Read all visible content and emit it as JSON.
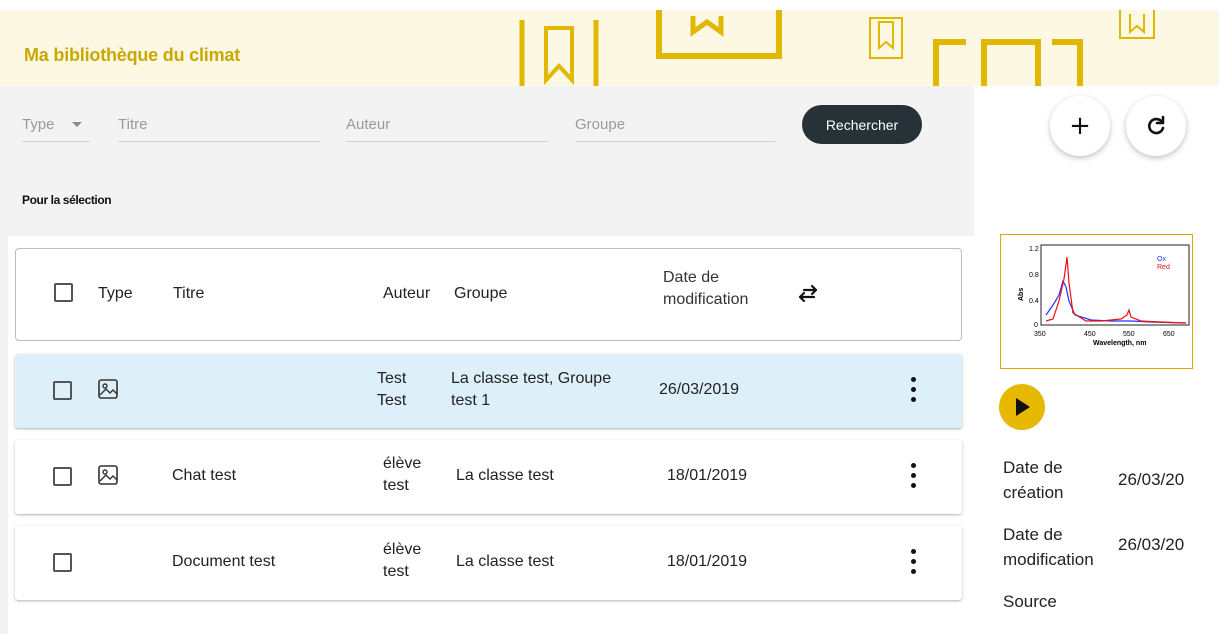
{
  "header": {
    "title": "Ma bibliothèque du climat"
  },
  "filters": {
    "type_label": "Type",
    "title_placeholder": "Titre",
    "author_placeholder": "Auteur",
    "group_placeholder": "Groupe",
    "search_label": "Rechercher"
  },
  "selection_label": "Pour la sélection",
  "table": {
    "columns": {
      "type": "Type",
      "title": "Titre",
      "author": "Auteur",
      "group": "Groupe",
      "date_line1": "Date de",
      "date_line2": "modification"
    },
    "rows": [
      {
        "title": "",
        "author_line1": "Test",
        "author_line2": "Test",
        "group_line1": "La classe test, Groupe",
        "group_line2": "test 1",
        "date": "26/03/2019",
        "has_image_icon": true,
        "selected": true
      },
      {
        "title": "Chat test",
        "author_line1": "élève",
        "author_line2": "test",
        "group_line1": "La classe test",
        "group_line2": "",
        "date": "18/01/2019",
        "has_image_icon": true,
        "selected": false
      },
      {
        "title": "Document test",
        "author_line1": "élève",
        "author_line2": "test",
        "group_line1": "La classe test",
        "group_line2": "",
        "date": "18/01/2019",
        "has_image_icon": false,
        "selected": false
      }
    ]
  },
  "side": {
    "add_icon": "plus-icon",
    "refresh_icon": "refresh-icon",
    "preview_chart": {
      "ylabel": "Abs",
      "xlabel": "Wavelength, nm",
      "yticks": [
        "1.2",
        "0.8",
        "0.4",
        "0"
      ],
      "xticks": [
        "350",
        "450",
        "550",
        "650"
      ],
      "legend": [
        "Ox",
        "Red"
      ],
      "colors": {
        "Ox": "#2233ff",
        "Red": "#ee1111"
      }
    },
    "details": {
      "created_label_line1": "Date de",
      "created_label_line2": "création",
      "created_value": "26/03/20",
      "modified_label_line1": "Date de",
      "modified_label_line2": "modification",
      "modified_value": "26/03/20",
      "source_label": "Source"
    }
  },
  "colors": {
    "brand": "#c9a800",
    "accent": "#e6b800",
    "selected_row": "#ddeff9",
    "search_button": "#263238"
  }
}
